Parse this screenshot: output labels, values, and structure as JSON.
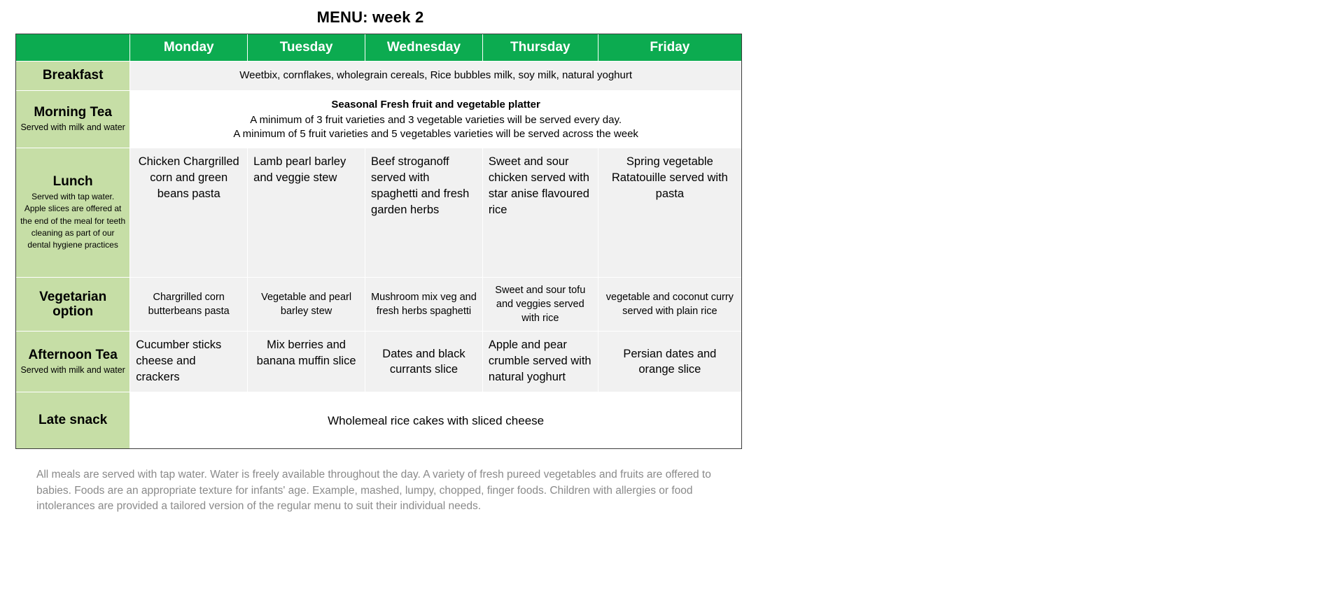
{
  "title": "MENU: week 2",
  "days": [
    "Monday",
    "Tuesday",
    "Wednesday",
    "Thursday",
    "Friday"
  ],
  "colors": {
    "header_green": "#0CAB50",
    "label_green": "#C6DEA6",
    "cell_grey": "#F1F1F1",
    "footnote_grey": "#8a8a8a",
    "border": "#3c3c3c"
  },
  "rows": {
    "breakfast": {
      "label": "Breakfast",
      "sub": "",
      "span_text": "Weetbix, cornflakes, wholegrain cereals, Rice bubbles milk, soy milk, natural yoghurt"
    },
    "morning_tea": {
      "label": "Morning Tea",
      "sub": "Served with milk and water",
      "line1": "Seasonal Fresh fruit and vegetable platter",
      "line2": "A minimum of 3 fruit varieties and 3 vegetable varieties will be served every day.",
      "line3": "A minimum of 5 fruit varieties and 5 vegetables varieties will be served across the week"
    },
    "lunch": {
      "label": "Lunch",
      "sub": "Served with tap water. Apple slices are offered at the end of the meal for teeth cleaning as part of our dental hygiene practices",
      "cells": [
        "Chicken Chargrilled corn and green beans pasta",
        "Lamb pearl barley and veggie stew",
        "Beef stroganoff served with spaghetti and fresh garden herbs",
        "Sweet and sour chicken served with star anise flavoured rice",
        "Spring vegetable Ratatouille served with pasta"
      ]
    },
    "vegetarian": {
      "label": "Vegetarian option",
      "sub": "",
      "cells": [
        "Chargrilled corn butterbeans pasta",
        "Vegetable and pearl barley stew",
        "Mushroom mix veg and fresh herbs spaghetti",
        "Sweet and sour tofu and veggies served with rice",
        "vegetable and coconut curry served with plain rice"
      ]
    },
    "afternoon_tea": {
      "label": "Afternoon Tea",
      "sub": "Served with milk and water",
      "cells": [
        "Cucumber sticks cheese and crackers",
        "Mix berries and banana muffin slice",
        "Dates and black currants slice",
        "Apple and pear crumble served with natural yoghurt",
        "Persian dates and orange slice"
      ]
    },
    "late_snack": {
      "label": "Late snack",
      "sub": "",
      "span_text": "Wholemeal rice cakes with sliced cheese"
    }
  },
  "footnote": "All meals are served with tap water. Water is freely available throughout the day. A variety of fresh pureed vegetables and fruits are offered to babies. Foods are an appropriate texture for infants' age. Example, mashed, lumpy, chopped, finger foods. Children with allergies or food intolerances are provided a tailored version of the regular menu to suit their individual needs."
}
